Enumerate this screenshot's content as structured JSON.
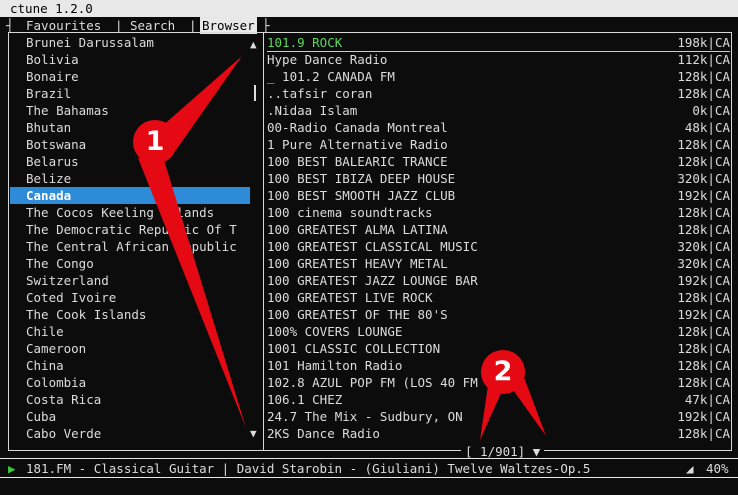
{
  "window": {
    "title": "ctune 1.2.0"
  },
  "tabs": [
    {
      "label": "Favourites",
      "active": false
    },
    {
      "label": "Search",
      "active": false
    },
    {
      "label": "Browser",
      "active": true
    }
  ],
  "tab_separators": {
    "left": "┤",
    "mid": "|",
    "right": "├"
  },
  "countries": [
    "Brunei Darussalam",
    "Bolivia",
    "Bonaire",
    "Brazil",
    "The Bahamas",
    "Bhutan",
    "Botswana",
    "Belarus",
    "Belize",
    "Canada",
    "The Cocos Keeling Islands",
    "The Democratic Republic Of T",
    "The Central African Republic",
    "The Congo",
    "Switzerland",
    "Coted Ivoire",
    "The Cook Islands",
    "Chile",
    "Cameroon",
    "China",
    "Colombia",
    "Costa Rica",
    "Cuba",
    "Cabo Verde"
  ],
  "selected_country_index": 9,
  "scroll": {
    "up": "▲",
    "down": "▼"
  },
  "stations": [
    {
      "name": "101.9 ROCK",
      "info": "198k|CA"
    },
    {
      "name": " Hype Dance Radio",
      "info": "112k|CA"
    },
    {
      "name": "_ 101.2 CANADA FM",
      "info": "128k|CA"
    },
    {
      "name": "..tafsir coran",
      "info": "128k|CA"
    },
    {
      "name": ".Nidaa Islam",
      "info": "0k|CA"
    },
    {
      "name": "00-Radio Canada Montreal",
      "info": "48k|CA"
    },
    {
      "name": "1 Pure Alternative Radio",
      "info": "128k|CA"
    },
    {
      "name": "100 BEST BALEARIC TRANCE",
      "info": "128k|CA"
    },
    {
      "name": "100 BEST IBIZA DEEP HOUSE",
      "info": "320k|CA"
    },
    {
      "name": "100 BEST SMOOTH JAZZ CLUB",
      "info": "192k|CA"
    },
    {
      "name": "100 cinema soundtracks",
      "info": "128k|CA"
    },
    {
      "name": "100 GREATEST ALMA LATINA",
      "info": "128k|CA"
    },
    {
      "name": "100 GREATEST CLASSICAL MUSIC",
      "info": "320k|CA"
    },
    {
      "name": "100 GREATEST HEAVY METAL",
      "info": "320k|CA"
    },
    {
      "name": "100 GREATEST JAZZ LOUNGE BAR",
      "info": "192k|CA"
    },
    {
      "name": "100 GREATEST LIVE ROCK",
      "info": "128k|CA"
    },
    {
      "name": "100 GREATEST OF THE 80'S",
      "info": "192k|CA"
    },
    {
      "name": "100% COVERS LOUNGE",
      "info": "128k|CA"
    },
    {
      "name": "1001 CLASSIC COLLECTION",
      "info": "128k|CA"
    },
    {
      "name": "101 Hamilton Radio",
      "info": "128k|CA"
    },
    {
      "name": "102.8 AZUL POP FM (LOS 40 FM",
      "info": "128k|CA"
    },
    {
      "name": "106.1 CHEZ",
      "info": "47k|CA"
    },
    {
      "name": "24.7 The Mix - Sudbury, ON",
      "info": "192k|CA"
    },
    {
      "name": "2KS Dance Radio",
      "info": "128k|CA"
    }
  ],
  "playing_station_index": 0,
  "pager": {
    "text": "[  1/901] ▼"
  },
  "status": {
    "play_icon": "▶",
    "text": "181.FM - Classical Guitar | David Starobin - (Giuliani) Twelve Waltzes-Op.5",
    "volume_icon": "◢",
    "volume": "40%"
  },
  "annotations": {
    "callout_1": "1",
    "callout_2": "2",
    "color": "#e50914"
  },
  "colors": {
    "selection": "#2d8bd8",
    "playing": "#5fd75f",
    "play_icon": "#39c63c"
  }
}
